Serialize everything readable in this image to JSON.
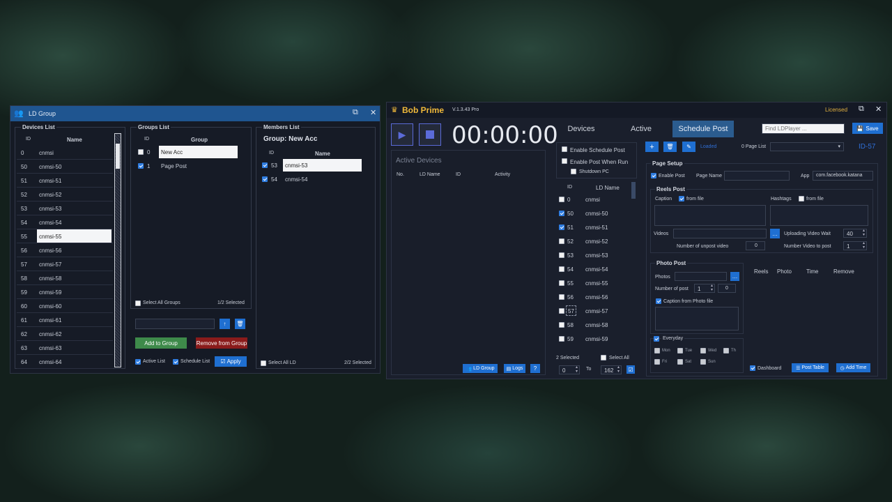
{
  "ldgroup": {
    "title": "LD Group",
    "devices": {
      "label": "Devices List",
      "col_id": "ID",
      "col_name": "Name",
      "rows": [
        {
          "id": "0",
          "name": "cnmsi"
        },
        {
          "id": "50",
          "name": "cnmsi-50"
        },
        {
          "id": "51",
          "name": "cnmsi-51"
        },
        {
          "id": "52",
          "name": "cnmsi-52"
        },
        {
          "id": "53",
          "name": "cnmsi-53"
        },
        {
          "id": "54",
          "name": "cnmsi-54"
        },
        {
          "id": "55",
          "name": "cnmsi-55"
        },
        {
          "id": "56",
          "name": "cnmsi-56"
        },
        {
          "id": "57",
          "name": "cnmsi-57"
        },
        {
          "id": "58",
          "name": "cnmsi-58"
        },
        {
          "id": "59",
          "name": "cnmsi-59"
        },
        {
          "id": "60",
          "name": "cnmsi-60"
        },
        {
          "id": "61",
          "name": "cnmsi-61"
        },
        {
          "id": "62",
          "name": "cnmsi-62"
        },
        {
          "id": "63",
          "name": "cnmsi-63"
        },
        {
          "id": "64",
          "name": "cnmsi-64"
        }
      ]
    },
    "groups": {
      "label": "Groups List",
      "col_id": "ID",
      "col_group": "Group",
      "rows": [
        {
          "id": "0",
          "name": "New Acc"
        },
        {
          "id": "1",
          "name": "Page Post"
        }
      ],
      "select_all": "Select All Groups",
      "count": "1/2 Selected",
      "add": "Add to Group",
      "remove": "Remove from Group",
      "active_list": "Active List",
      "schedule_list": "Schedule List",
      "apply": "Apply"
    },
    "members": {
      "label": "Members List",
      "group": "Group: New Acc",
      "col_id": "ID",
      "col_name": "Name",
      "rows": [
        {
          "id": "53",
          "name": "cnmsi-53"
        },
        {
          "id": "54",
          "name": "cnmsi-54"
        }
      ],
      "select_all": "Select All LD",
      "count": "2/2 Selected"
    }
  },
  "bob": {
    "title": "Bob Prime",
    "version": "V.1.3.43 Pro",
    "licensed": "Licensed",
    "timer": "00:00:00",
    "tabs": [
      "Devices",
      "Active",
      "Schedule Post"
    ],
    "find_placeholder": "Find LDPlayer ...",
    "save": "Save",
    "active_devices": {
      "label": "Active Devices",
      "cols": [
        "No.",
        "LD Name",
        "ID",
        "Activity"
      ]
    },
    "ld_group_btn": "LD Group",
    "logs_btn": "Logs",
    "sched": {
      "enable": "Enable Schedule Post",
      "enable_run": "Enable Post When Run",
      "shutdown": "Shutdown PC",
      "col_id": "ID",
      "col_name": "LD Name",
      "rows": [
        {
          "id": "0",
          "name": "cnmsi"
        },
        {
          "id": "50",
          "name": "cnmsi-50"
        },
        {
          "id": "51",
          "name": "cnmsi-51"
        },
        {
          "id": "52",
          "name": "cnmsi-52"
        },
        {
          "id": "53",
          "name": "cnmsi-53"
        },
        {
          "id": "54",
          "name": "cnmsi-54"
        },
        {
          "id": "55",
          "name": "cnmsi-55"
        },
        {
          "id": "56",
          "name": "cnmsi-56"
        },
        {
          "id": "57",
          "name": "cnmsi-57"
        },
        {
          "id": "58",
          "name": "cnmsi-58"
        },
        {
          "id": "59",
          "name": "cnmsi-59"
        }
      ],
      "selected": "2 Selected",
      "select_all": "Select All",
      "from": "0",
      "to_label": "To",
      "to": "162"
    },
    "page": {
      "loaded": "Loaded",
      "page_list": "0 Page List",
      "id": "ID-57",
      "setup": "Page Setup",
      "enable_post": "Enable Post",
      "page_name": "Page Name",
      "app": "App",
      "app_val": "com.facebook.katana",
      "reels": "Reels Post",
      "caption": "Caption",
      "from_file": "from file",
      "hashtags": "Hashtags",
      "videos": "Videos",
      "upload_wait": "Uploading Video Wait",
      "upload_wait_val": "40",
      "unpost": "Number of unpost video",
      "unpost_val": "0",
      "num_video": "Number Video to post",
      "num_video_val": "1",
      "photo_post": "Photo Post",
      "photos": "Photos",
      "num_post": "Number of post",
      "num_post_a": "1",
      "num_post_b": "0",
      "caption_photo": "Caption from Photo file",
      "table_cols": [
        "Reels",
        "Photo",
        "Time",
        "Remove"
      ],
      "everyday": "Everyday",
      "days": [
        "Mon",
        "Tue",
        "Wed",
        "Th",
        "Fri",
        "Sat",
        "Sun"
      ],
      "dashboard": "Dashboard",
      "post_table": "Post Table",
      "add_time": "Add Time"
    }
  }
}
